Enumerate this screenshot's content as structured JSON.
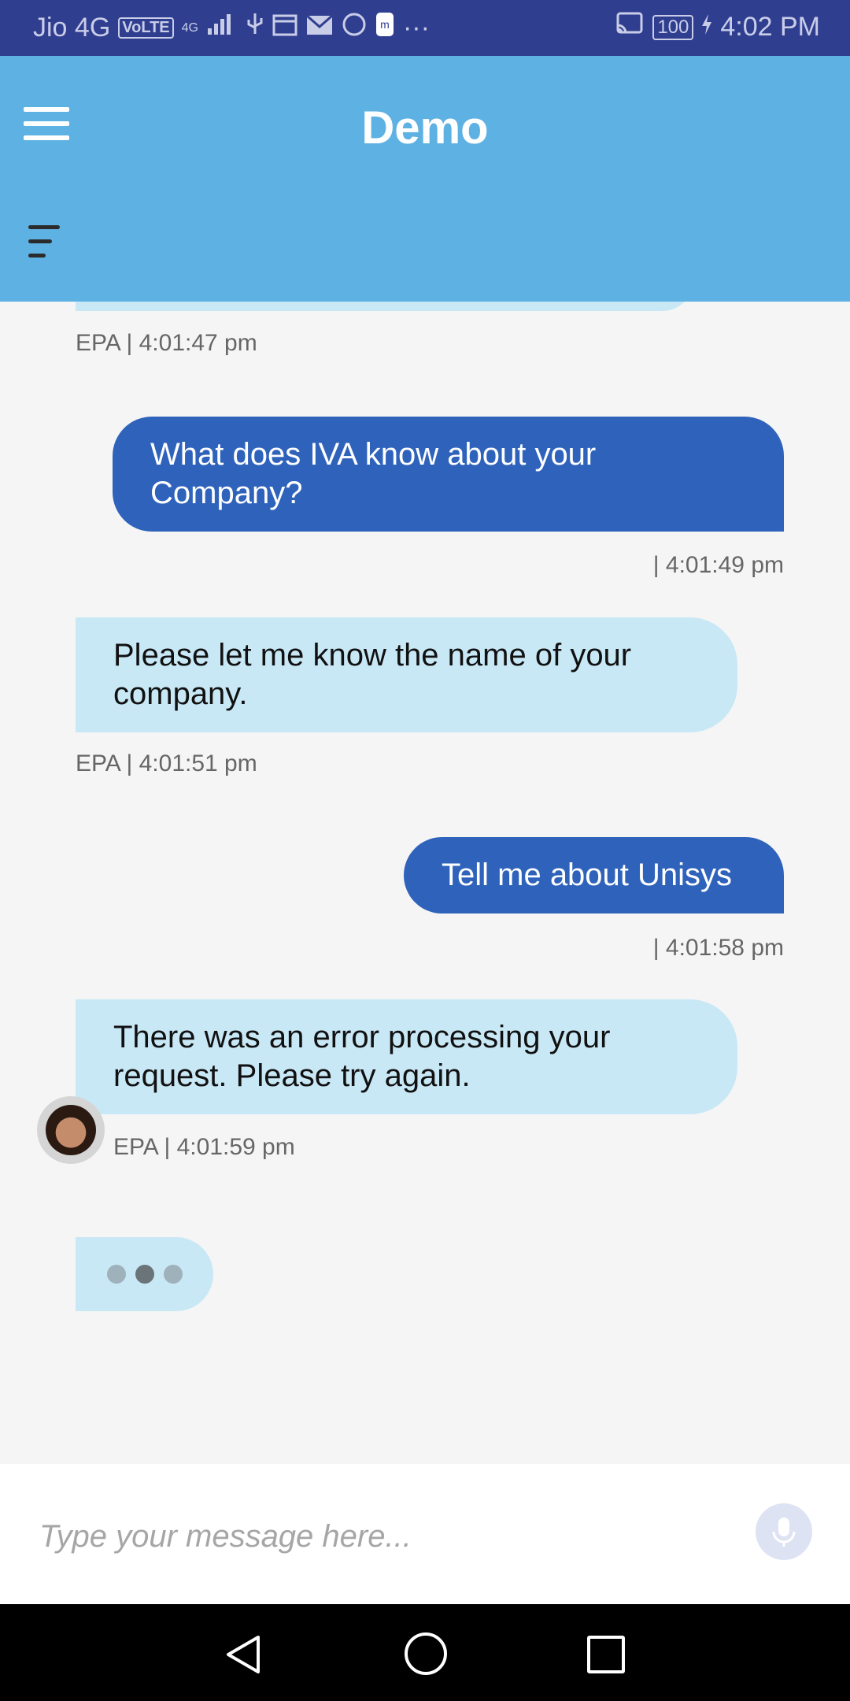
{
  "status_bar": {
    "carrier": "Jio 4G",
    "volte": "VoLTE",
    "network": "4G",
    "battery": "100",
    "time": "4:02 PM",
    "more": "···"
  },
  "app_bar": {
    "title": "Demo"
  },
  "messages": [
    {
      "sender": "bot",
      "meta": "EPA | 4:01:47 pm"
    },
    {
      "sender": "user",
      "text": "What does IVA know about your Company?",
      "meta": "| 4:01:49 pm"
    },
    {
      "sender": "bot",
      "text": "Please let me know the name of your company.",
      "meta": "EPA | 4:01:51 pm"
    },
    {
      "sender": "user",
      "text": "Tell me about Unisys",
      "meta": "| 4:01:58 pm"
    },
    {
      "sender": "bot",
      "text": "There was an error processing your request. Please try again.",
      "meta": "EPA | 4:01:59 pm"
    }
  ],
  "composer": {
    "placeholder": "Type your message here..."
  },
  "colors": {
    "status_bar": "#2f3e8f",
    "app_bar": "#5eb1e3",
    "user_bubble": "#2f63bb",
    "bot_bubble": "#c9e8f6",
    "chat_background": "#f5f5f5"
  },
  "icons": {
    "menu": "hamburger-menu-icon",
    "sort": "sort-lines-icon",
    "mic": "microphone-icon",
    "back": "nav-back-icon",
    "home": "nav-home-icon",
    "recent": "nav-recent-icon"
  }
}
